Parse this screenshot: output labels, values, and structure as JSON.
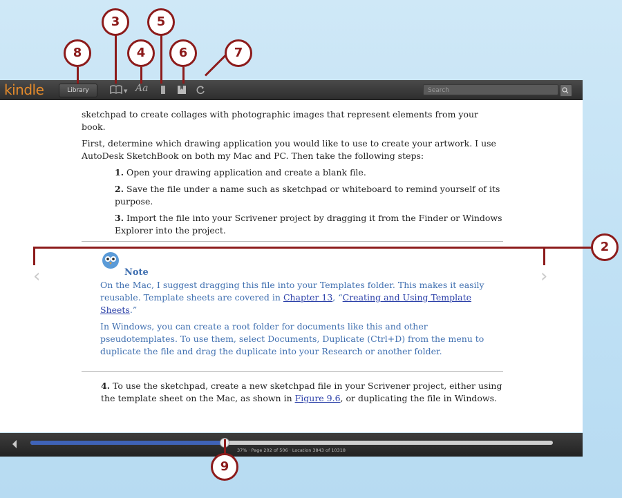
{
  "toolbar": {
    "logo": "kindle",
    "library_label": "Library",
    "search_placeholder": "Search",
    "icons": [
      "book-icon",
      "font-icon",
      "bookmark-icon",
      "note-icon",
      "sync-icon",
      "search-icon"
    ]
  },
  "page": {
    "para1": "sketchpad to create collages with photographic images that represent elements from your book.",
    "para2": "First, determine which drawing application you would like to use to create your artwork. I use AutoDesk SketchBook on both my Mac and PC. Then take the following steps:",
    "steps": [
      {
        "num": "1.",
        "text": " Open your drawing application and create a blank file."
      },
      {
        "num": "2.",
        "text": " Save the file under a name such as sketchpad or whiteboard to remind yourself of its purpose."
      },
      {
        "num": "3.",
        "text": " Import the file into your Scrivener project by dragging it from the Finder or Windows Explorer into the project."
      }
    ],
    "note": {
      "title": "Note",
      "p1_a": "On the Mac, I suggest dragging this file into your Templates folder. This makes it easily reusable. Template sheets are covered in ",
      "p1_link1": "Chapter 13",
      "p1_b": ", “",
      "p1_link2": "Creating and Using Template Sheets",
      "p1_c": ".”",
      "p2": "In Windows, you can create a root folder for documents like this and other pseudotemplates. To use them, select Documents, Duplicate (Ctrl+D) from the menu to duplicate the file and drag the duplicate into your Research or another folder."
    },
    "step4": {
      "num": "4.",
      "text_a": " To use the sketchpad, create a new sketchpad file in your Scrivener project, either using the template sheet on the Mac, as shown in ",
      "link": "Figure 9.6",
      "text_b": ", or duplicating the file in Windows."
    }
  },
  "progress": {
    "percent": 37,
    "info": "37% · Page 202 of 506 · Location 3843 of 10318"
  },
  "callouts": [
    "8",
    "3",
    "4",
    "5",
    "6",
    "7",
    "2",
    "9"
  ],
  "colors": {
    "callout": "#8c1b1b",
    "note_text": "#3f6fb0",
    "progress_fill": "#3f63b8",
    "logo": "#e38a2b"
  }
}
